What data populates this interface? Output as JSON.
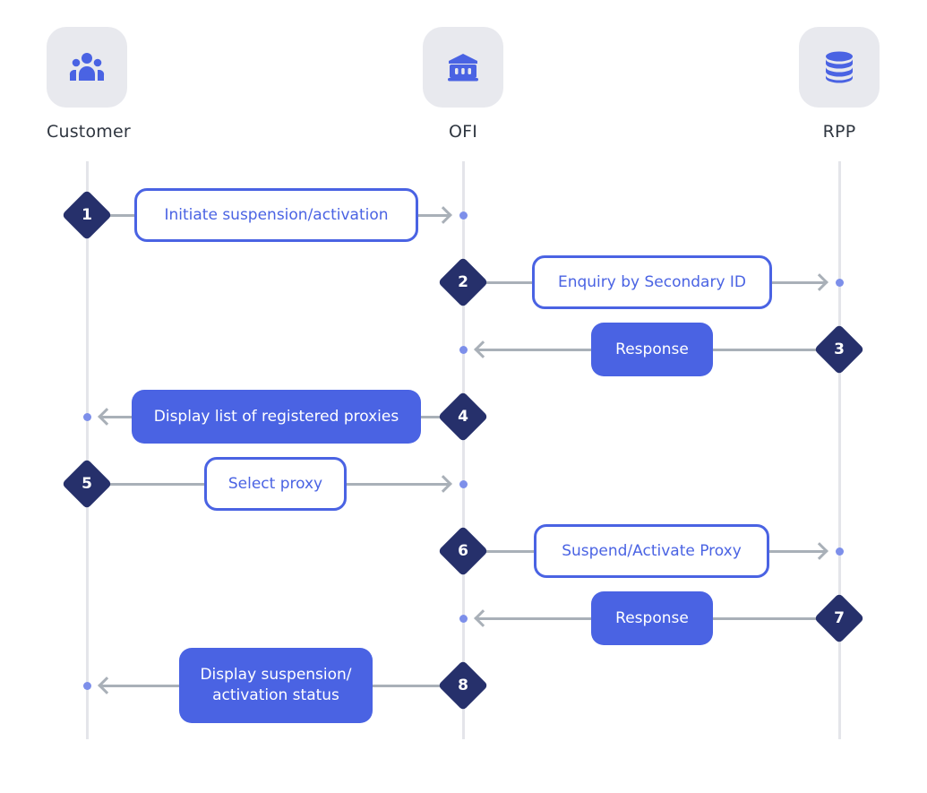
{
  "diagram": {
    "type": "sequence",
    "colors": {
      "accent": "#4a63e3",
      "step_badge": "#26306b",
      "connector": "#a9b0b8",
      "lifeline": "#e4e5ea",
      "icon_tile": "#e8e9ee",
      "endpoint_dot": "#7d8fea",
      "actor_label": "#2f3640"
    },
    "actors": [
      {
        "id": "customer",
        "label": "Customer",
        "icon": "users-group-icon"
      },
      {
        "id": "ofi",
        "label": "OFI",
        "icon": "bank-building-icon"
      },
      {
        "id": "rpp",
        "label": "RPP",
        "icon": "database-icon"
      }
    ],
    "steps": [
      {
        "number": "1",
        "from": "customer",
        "to": "ofi",
        "label": "Initiate suspension/activation",
        "style": "outline"
      },
      {
        "number": "2",
        "from": "ofi",
        "to": "rpp",
        "label": "Enquiry by Secondary ID",
        "style": "outline"
      },
      {
        "number": "3",
        "from": "rpp",
        "to": "ofi",
        "label": "Response",
        "style": "filled"
      },
      {
        "number": "4",
        "from": "ofi",
        "to": "customer",
        "label": "Display list of registered proxies",
        "style": "filled"
      },
      {
        "number": "5",
        "from": "customer",
        "to": "ofi",
        "label": "Select proxy",
        "style": "outline"
      },
      {
        "number": "6",
        "from": "ofi",
        "to": "rpp",
        "label": "Suspend/Activate Proxy",
        "style": "outline"
      },
      {
        "number": "7",
        "from": "rpp",
        "to": "ofi",
        "label": "Response",
        "style": "filled"
      },
      {
        "number": "8",
        "from": "ofi",
        "to": "customer",
        "label": "Display suspension/ activation status",
        "style": "filled"
      }
    ]
  }
}
